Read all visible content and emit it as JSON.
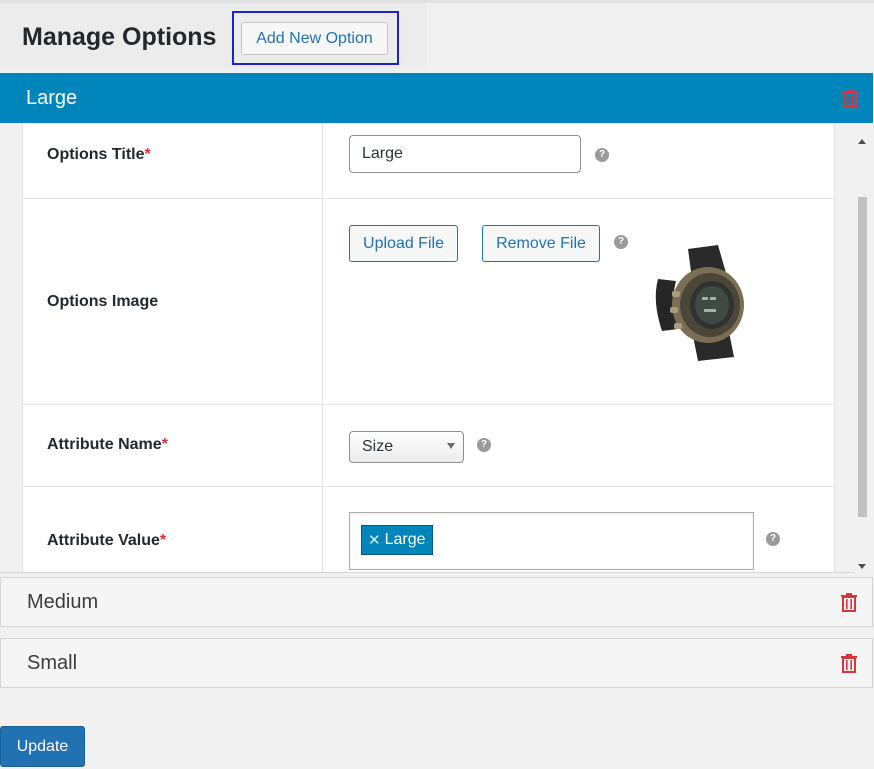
{
  "header": {
    "title": "Manage Options",
    "add_button_label": "Add New Option"
  },
  "options": [
    {
      "title": "Large",
      "state": "expanded"
    },
    {
      "title": "Medium",
      "state": "collapsed"
    },
    {
      "title": "Small",
      "state": "collapsed"
    }
  ],
  "form": {
    "title_label": "Options Title",
    "title_value": "Large",
    "image_label": "Options Image",
    "upload_label": "Upload File",
    "remove_label": "Remove File",
    "image_icon": "watch-image",
    "attr_name_label": "Attribute Name",
    "attr_name_selected": "Size",
    "attr_value_label": "Attribute Value",
    "attr_value_tags": [
      "Large"
    ],
    "required_mark": "*",
    "help_glyph": "?"
  },
  "footer": {
    "update_label": "Update"
  },
  "colors": {
    "accent": "#0085ba",
    "primary_button": "#2271b1",
    "delete_icon": "#d63638",
    "focus_ring": "#1a24c9"
  }
}
